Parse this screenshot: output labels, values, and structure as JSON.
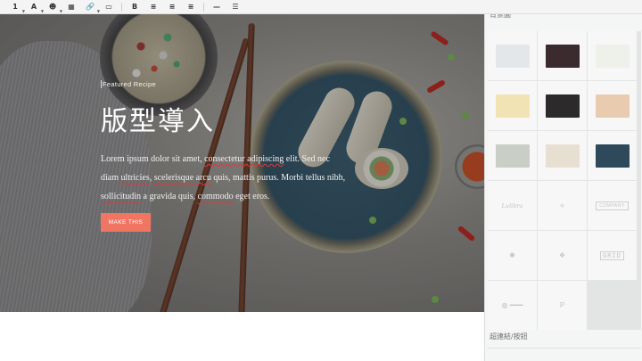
{
  "toolbar": {
    "items": [
      {
        "icon": "heading-icon",
        "glyph": "1",
        "caret": true
      },
      {
        "icon": "text-color-icon",
        "glyph": "A",
        "caret": true
      },
      {
        "icon": "emoji-icon",
        "glyph": "☻",
        "caret": true
      },
      {
        "icon": "table-icon",
        "glyph": "▦",
        "caret": false
      },
      {
        "icon": "link-icon",
        "glyph": "🔗",
        "caret": true
      },
      {
        "icon": "media-icon",
        "glyph": "▭",
        "caret": false
      },
      {
        "icon": "bold-icon",
        "glyph": "B",
        "caret": false
      },
      {
        "icon": "align-left-icon",
        "glyph": "≡",
        "caret": false
      },
      {
        "icon": "align-center-icon",
        "glyph": "≡",
        "caret": false
      },
      {
        "icon": "align-justify-icon",
        "glyph": "≡",
        "caret": false
      },
      {
        "icon": "horizontal-rule-icon",
        "glyph": "—",
        "caret": false
      },
      {
        "icon": "list-icon",
        "glyph": "☰",
        "caret": false
      }
    ]
  },
  "hero": {
    "eyebrow": "Featured Recipe",
    "title": "版型導入",
    "body_parts": [
      {
        "text": "Lorem ipsum dolor sit amet, ",
        "spell": false
      },
      {
        "text": "consectetur adipiscing",
        "spell": true
      },
      {
        "text": " elit. Sed nec diam ",
        "spell": false
      },
      {
        "text": "ultricies",
        "spell": true
      },
      {
        "text": ", ",
        "spell": false
      },
      {
        "text": "scelerisque",
        "spell": true
      },
      {
        "text": " ",
        "spell": false
      },
      {
        "text": "arcu",
        "spell": true
      },
      {
        "text": " quis, mattis purus. Morbi tellus nibh, ",
        "spell": false
      },
      {
        "text": "sollicitudin",
        "spell": true
      },
      {
        "text": " a gravida quis, ",
        "spell": false
      },
      {
        "text": "commodo",
        "spell": true
      },
      {
        "text": " eget eros.",
        "spell": false
      }
    ],
    "cta_label": "MAKE THIS",
    "cta_color": "#f07563"
  },
  "panel": {
    "header": "背景圖",
    "photo_thumbnails": [
      {
        "name": "thumb-milk",
        "color": "#e4e7ea"
      },
      {
        "name": "thumb-candles",
        "color": "#3b2a2e"
      },
      {
        "name": "thumb-broccoli",
        "color": "#eef0ea"
      },
      {
        "name": "thumb-juice",
        "color": "#f2e3b5"
      },
      {
        "name": "thumb-dish",
        "color": "#2c2a2b"
      },
      {
        "name": "thumb-croissant",
        "color": "#e9cbb0"
      },
      {
        "name": "thumb-shrimp-platter",
        "color": "#c9cfc7"
      },
      {
        "name": "thumb-cake",
        "color": "#e7dfd2"
      },
      {
        "name": "thumb-spring-rolls",
        "color": "#2e4a5a"
      }
    ],
    "logo_thumbnails": [
      {
        "name": "logo-script",
        "style": "logo-txt",
        "text": "Lulibra"
      },
      {
        "name": "logo-mark-a",
        "style": "logo-mark",
        "text": "⟡"
      },
      {
        "name": "logo-boxed",
        "style": "logo-box",
        "text": "COMPANY"
      },
      {
        "name": "logo-ornament",
        "style": "logo-mark",
        "text": "✺"
      },
      {
        "name": "logo-emblem",
        "style": "logo-mark",
        "text": "❖"
      },
      {
        "name": "logo-grid",
        "style": "logo-grid",
        "text": "GRID"
      },
      {
        "name": "logo-wide",
        "style": "logo-mark",
        "text": "◍ ━━━"
      },
      {
        "name": "logo-monogram",
        "style": "logo-mark",
        "text": "P"
      }
    ],
    "footer": "超連結/按鈕"
  }
}
